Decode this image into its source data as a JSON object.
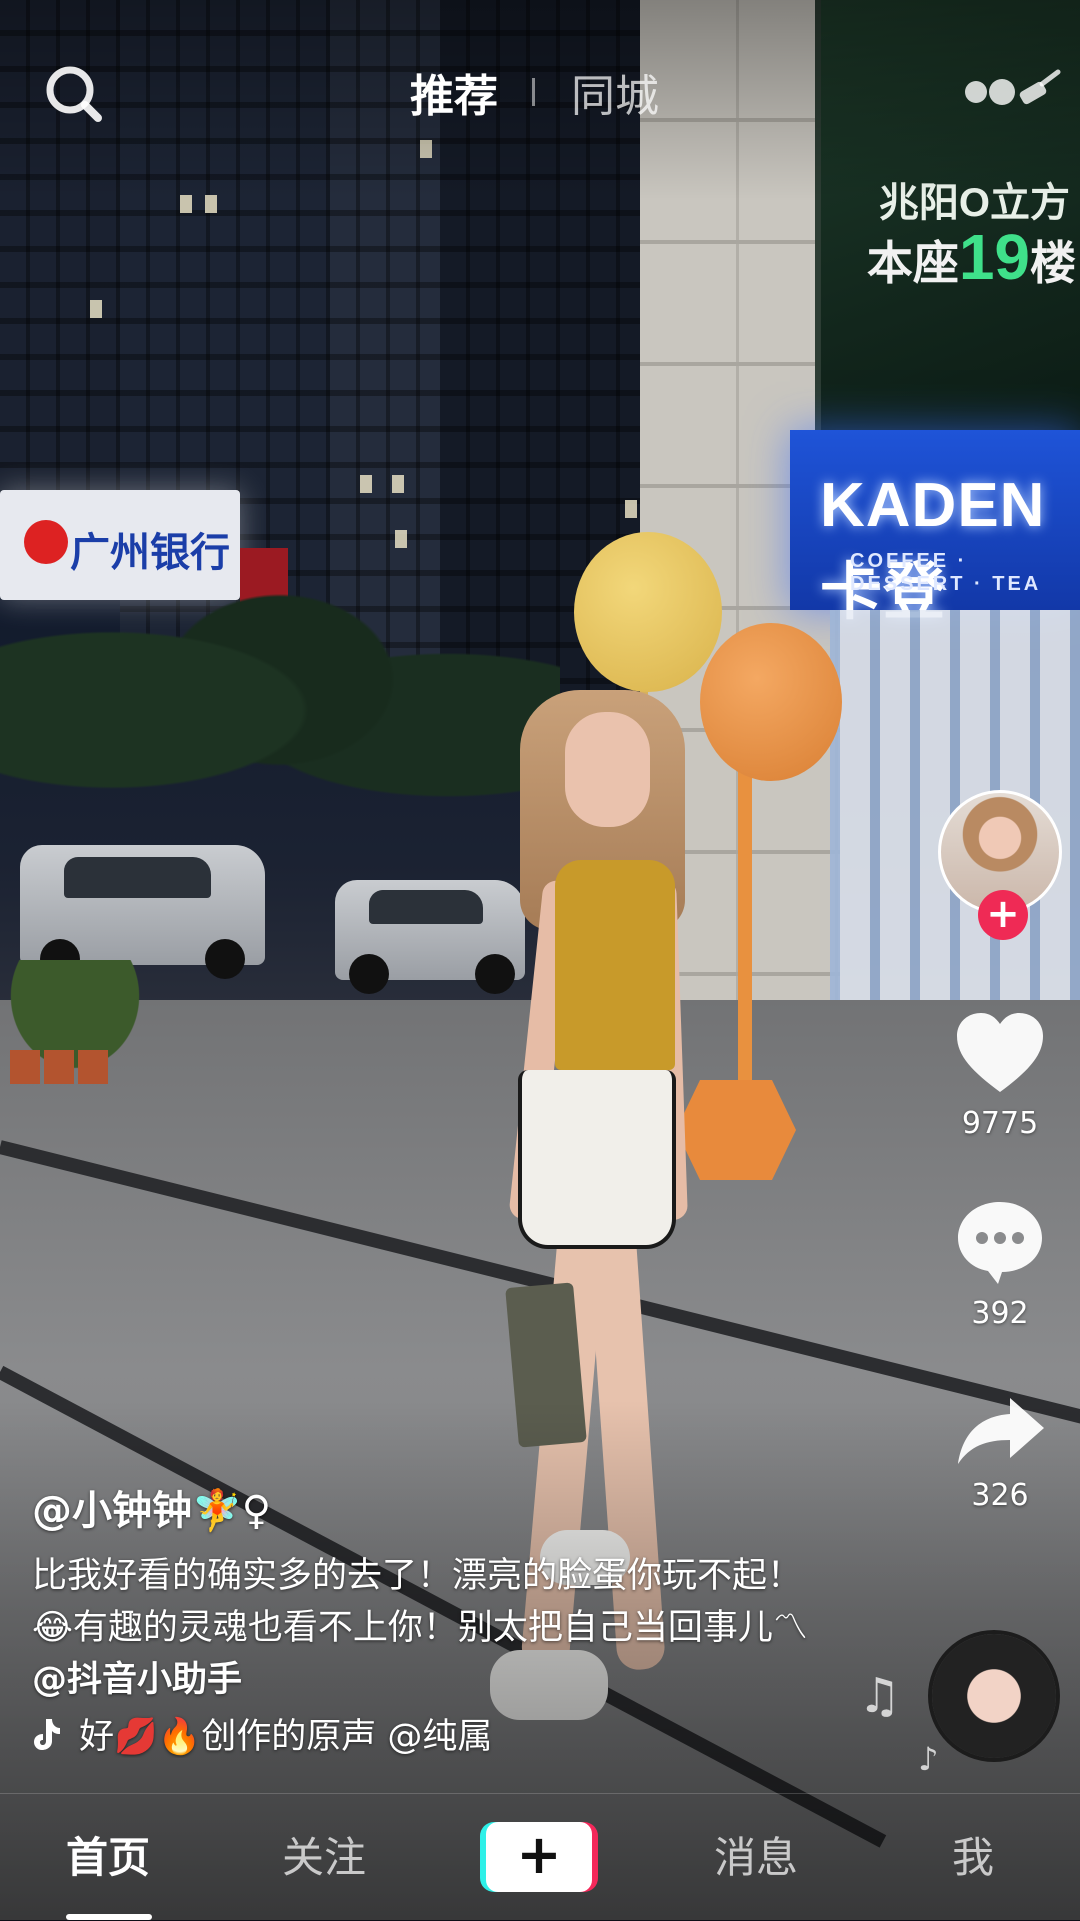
{
  "header": {
    "tabs": [
      {
        "label": "推荐",
        "active": true
      },
      {
        "label": "同城",
        "active": false
      }
    ]
  },
  "scene_text": {
    "shop_sign": "KADEN卡登",
    "shop_sub": "COFFEE · DESSERT · TEA",
    "bank_sign": "广州银行",
    "billboard_line1": "兆阳O立方",
    "billboard_line2a": "本座",
    "billboard_line2b": "19",
    "billboard_line2c": "楼"
  },
  "creator": {
    "follow_symbol": "+"
  },
  "actions": {
    "likes": "9775",
    "comments": "392",
    "shares": "326"
  },
  "post": {
    "username": "@小钟钟🧚♀",
    "caption_text": "比我好看的确实多的去了！漂亮的脸蛋你玩不起！😂有趣的灵魂也看不上你！别太把自己当回事儿〽",
    "caption_mention": "@抖音小助手",
    "music_text": "好💋🔥创作的原声    @纯属"
  },
  "bottom_nav": {
    "items": [
      {
        "label": "首页",
        "active": true
      },
      {
        "label": "关注",
        "active": false
      },
      {
        "label": "消息",
        "active": false
      },
      {
        "label": "我",
        "active": false
      }
    ],
    "create_symbol": "+"
  },
  "colors": {
    "follow_badge": "#ef2a55",
    "create_left_shadow": "#2ef0e8",
    "create_right_shadow": "#f4285a",
    "balloon_yellow": "#e8c35a",
    "balloon_orange": "#e8913f"
  }
}
